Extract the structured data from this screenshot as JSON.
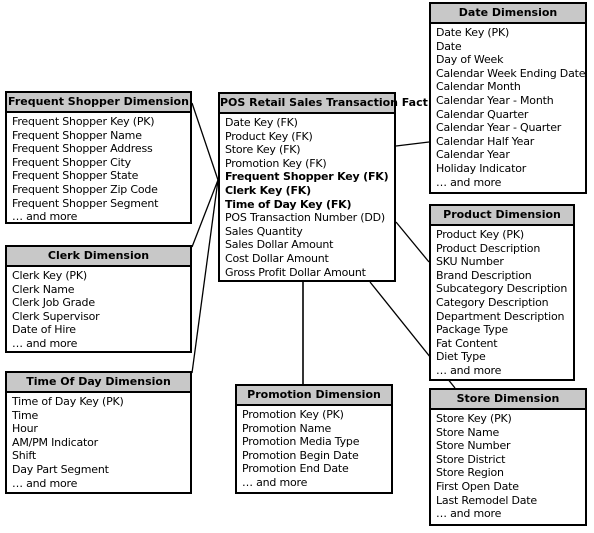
{
  "fact": {
    "title": "POS Retail Sales Transaction Fact",
    "attributes": [
      {
        "text": "Date Key (FK)",
        "bold": false
      },
      {
        "text": "Product Key (FK)",
        "bold": false
      },
      {
        "text": "Store Key (FK)",
        "bold": false
      },
      {
        "text": "Promotion Key (FK)",
        "bold": false
      },
      {
        "text": "Frequent Shopper Key (FK)",
        "bold": true
      },
      {
        "text": "Clerk Key (FK)",
        "bold": true
      },
      {
        "text": "Time of Day Key (FK)",
        "bold": true
      },
      {
        "text": "POS Transaction Number (DD)",
        "bold": false
      },
      {
        "text": "Sales Quantity",
        "bold": false
      },
      {
        "text": "Sales Dollar Amount",
        "bold": false
      },
      {
        "text": "Cost Dollar Amount",
        "bold": false
      },
      {
        "text": "Gross Profit Dollar Amount",
        "bold": false
      }
    ]
  },
  "dimensions": {
    "date": {
      "title": "Date Dimension",
      "attributes": [
        "Date Key (PK)",
        "Date",
        "Day of Week",
        "Calendar Week Ending Date",
        "Calendar Month",
        "Calendar Year - Month",
        "Calendar Quarter",
        "Calendar Year - Quarter",
        "Calendar Half Year",
        "Calendar Year",
        "Holiday Indicator",
        "… and more"
      ]
    },
    "frequent_shopper": {
      "title": "Frequent Shopper Dimension",
      "attributes": [
        "Frequent Shopper Key (PK)",
        "Frequent Shopper Name",
        "Frequent Shopper Address",
        "Frequent Shopper City",
        "Frequent Shopper State",
        "Frequent Shopper Zip Code",
        "Frequent Shopper Segment",
        "… and more"
      ]
    },
    "clerk": {
      "title": "Clerk Dimension",
      "attributes": [
        "Clerk Key (PK)",
        "Clerk Name",
        "Clerk Job Grade",
        "Clerk Supervisor",
        "Date of Hire",
        "… and more"
      ]
    },
    "time_of_day": {
      "title": "Time Of Day Dimension",
      "attributes": [
        "Time of Day Key (PK)",
        "Time",
        "Hour",
        "AM/PM Indicator",
        "Shift",
        "Day Part Segment",
        "… and more"
      ]
    },
    "promotion": {
      "title": "Promotion Dimension",
      "attributes": [
        "Promotion Key (PK)",
        "Promotion Name",
        "Promotion Media Type",
        "Promotion Begin Date",
        "Promotion End Date",
        "… and more"
      ]
    },
    "product": {
      "title": "Product Dimension",
      "attributes": [
        "Product Key (PK)",
        "Product Description",
        "SKU  Number",
        "Brand Description",
        "Subcategory Description",
        "Category Description",
        "Department Description",
        "Package Type",
        "Fat Content",
        "Diet Type",
        "… and more"
      ]
    },
    "store": {
      "title": "Store Dimension",
      "attributes": [
        "Store Key (PK)",
        "Store Name",
        "Store Number",
        "Store District",
        "Store Region",
        "First Open Date",
        "Last Remodel Date",
        "… and more"
      ]
    }
  },
  "colors": {
    "header_fill": "#c8c8c8",
    "border": "#000000"
  }
}
